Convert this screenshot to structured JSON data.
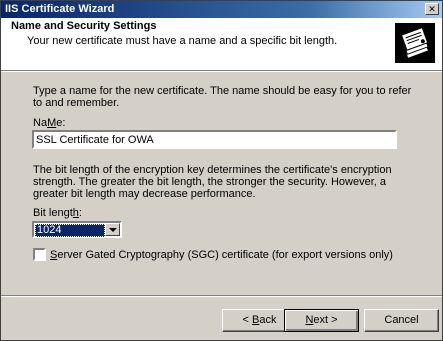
{
  "window": {
    "title": "IIS Certificate Wizard",
    "close_glyph": "✕"
  },
  "header": {
    "title": "Name and Security Settings",
    "subtitle": "Your new certificate must have a name and a specific bit length."
  },
  "form": {
    "intro": "Type a name for the new certificate. The name should be easy for you to refer to and remember.",
    "name_label_mnemonic": "M",
    "name_label_rest": "e:",
    "name_label_prefix": "Na",
    "name_value": "SSL Certificate for OWA",
    "description": "The bit length of the encryption key determines the certificate's encryption strength. The greater the bit length, the stronger the security.  However, a greater bit length may decrease performance.",
    "bit_label_prefix": "Bit lengt",
    "bit_label_mnemonic": "h",
    "bit_label_rest": ":",
    "bit_length_value": "1024",
    "sgc_checked": false,
    "sgc_label_mnemonic": "S",
    "sgc_label_rest": "erver Gated Cryptography (SGC) certificate (for export versions only)"
  },
  "buttons": {
    "back_prefix": "< ",
    "back_mnemonic": "B",
    "back_rest": "ack",
    "next_mnemonic": "N",
    "next_rest": "ext >",
    "cancel": "Cancel"
  },
  "icons": {
    "wizard": "certificate-stack-icon",
    "dropdown": "chevron-down-icon"
  }
}
